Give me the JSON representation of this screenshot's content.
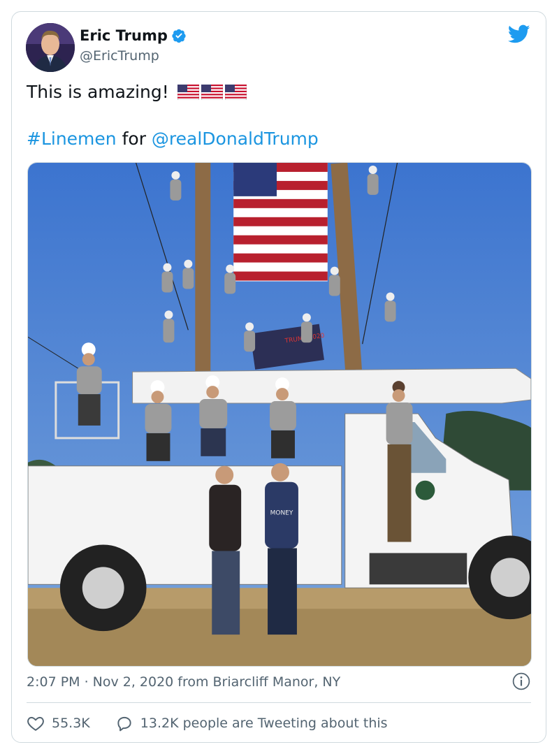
{
  "user": {
    "display_name": "Eric Trump",
    "handle": "@EricTrump",
    "avatar_icon": "profile-avatar",
    "verified_icon": "verified-badge-icon"
  },
  "tweet": {
    "text": "This is amazing!",
    "flags": [
      "us-flag-emoji",
      "us-flag-emoji",
      "us-flag-emoji"
    ],
    "hashtag": "#Linemen",
    "connector": "for",
    "mention": "@realDonaldTrump"
  },
  "media": {
    "type": "photo",
    "banner_text": "TRUMP 2020",
    "shirt_text": "MONEY"
  },
  "meta": {
    "time": "2:07 PM",
    "separator": "·",
    "date": "Nov 2, 2020",
    "source": "from Briarcliff Manor, NY"
  },
  "actions": {
    "likes": "55.3K",
    "tweeting": "13.2K people are Tweeting about this"
  },
  "colors": {
    "link": "#1b95e0",
    "muted": "#536471",
    "border": "#cfd9de",
    "brand": "#1d9bf0"
  }
}
